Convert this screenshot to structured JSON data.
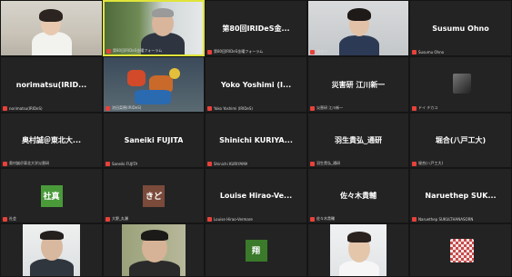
{
  "meeting": {
    "participants": [
      {
        "name": "",
        "label": "",
        "video": "woman-office"
      },
      {
        "name": "",
        "label": "第80回IRIDeS金曜フォーラム",
        "video": "man-outdoor",
        "active": true
      },
      {
        "name": "第80回IRIDeS金...",
        "label": "第80回IRIDeS金曜フォーラム"
      },
      {
        "name": "",
        "label": "長谷川",
        "video": "young-man"
      },
      {
        "name": "Susumu Ohno",
        "label": "Susumu Ohno"
      },
      {
        "name": "norimatsu(IRID...",
        "label": "norimatsu(IRIDeS)"
      },
      {
        "name": "",
        "label": "池田菜穂(IRIDeS)",
        "video": "objects"
      },
      {
        "name": "Yoko Yoshimi (I...",
        "label": "Yoko Yoshimi (IRIDeS)"
      },
      {
        "name": "災害研 江川新一",
        "label": "災害研 江川新一"
      },
      {
        "name": "",
        "label": "ドイ チカコ",
        "video": "photo-small"
      },
      {
        "name": "奥村誠＠東北大...",
        "label": "奥村誠＠東北大学災害研"
      },
      {
        "name": "Saneiki FUJITA",
        "label": "Saneiki FUJITA"
      },
      {
        "name": "Shinichi KURIYA...",
        "label": "Shinichi KURIYAMA"
      },
      {
        "name": "羽生貴弘_通研",
        "label": "羽生貴弘_通研"
      },
      {
        "name": "堀合(八戸工大)",
        "label": "堀合(八戸工大)"
      },
      {
        "name": "",
        "label": "社会",
        "avatar": "社真",
        "avatar_color": "#4a9a3a"
      },
      {
        "name": "",
        "label": "大野_丸瀬",
        "avatar": "きど",
        "avatar_color": "#7a4a3a"
      },
      {
        "name": "Louise Hirao-Ve...",
        "label": "Louise Hirao-Vermare"
      },
      {
        "name": "佐々木貴輔",
        "label": "佐々木貴輔"
      },
      {
        "name": "Naruethep SUK...",
        "label": "Naruethep SUKULTHANASORN"
      },
      {
        "name": "",
        "label": "",
        "video": "man-glasses-white"
      },
      {
        "name": "",
        "label": "",
        "video": "man-glasses-green"
      },
      {
        "name": "",
        "label": "",
        "avatar": "翔",
        "avatar_color": "#3a7a2a"
      },
      {
        "name": "",
        "label": "",
        "video": "man-white-bg"
      },
      {
        "name": "",
        "label": "",
        "video": "qr-pattern"
      }
    ]
  }
}
